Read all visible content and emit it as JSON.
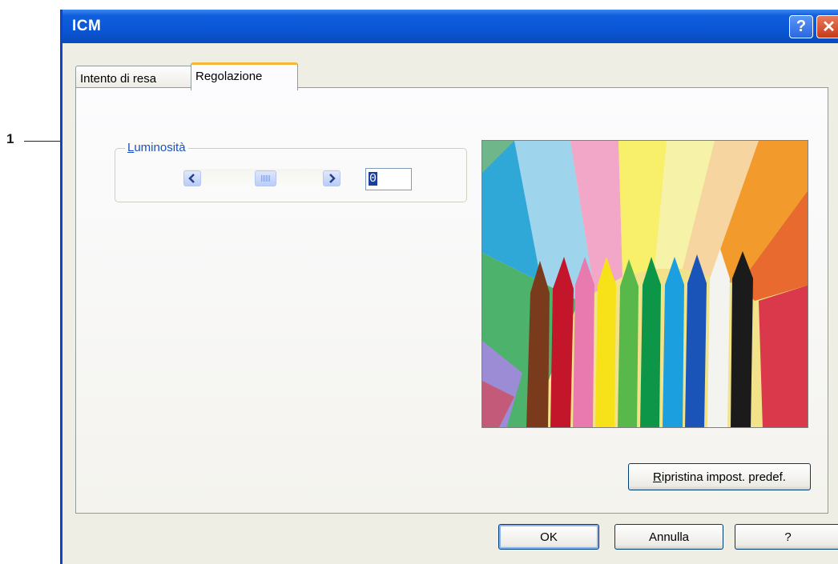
{
  "callout": {
    "number": "1"
  },
  "window": {
    "title": "ICM",
    "help_button": "?",
    "close_button": "✕"
  },
  "tabs": [
    {
      "label": "Intento di resa",
      "active": false
    },
    {
      "label": "Regolazione",
      "active": true
    }
  ],
  "brightness": {
    "label_first": "L",
    "label_rest": "uminosità",
    "value": "0",
    "slider_level": 0.5
  },
  "buttons": {
    "reset_first": "R",
    "reset_rest": "ipristina impost. predef.",
    "ok": "OK",
    "cancel": "Annulla",
    "help": "?"
  },
  "colors": {
    "titlebar": "#0a56d6",
    "label_blue": "#1b4fc6",
    "close_red": "#c73a18"
  }
}
